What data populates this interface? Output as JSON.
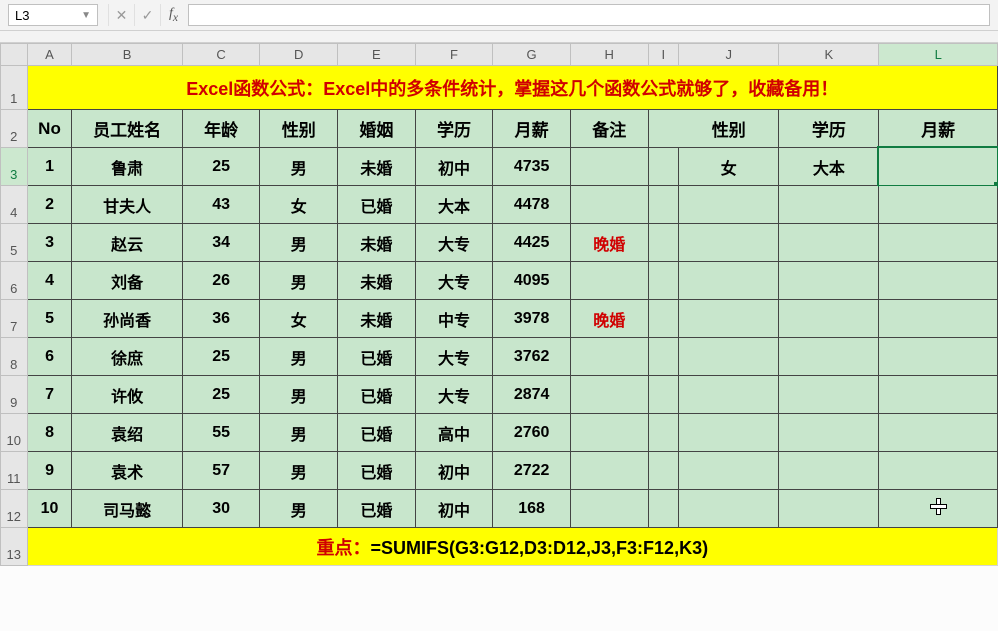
{
  "namebox": "L3",
  "formula_input": "",
  "columns": [
    "A",
    "B",
    "C",
    "D",
    "E",
    "F",
    "G",
    "H",
    "I",
    "J",
    "K",
    "L"
  ],
  "active_col": "L",
  "active_row": 3,
  "banner_text": "Excel函数公式：Excel中的多条件统计，掌握这几个函数公式就够了，收藏备用！",
  "headers": {
    "A": "No",
    "B": "员工姓名",
    "C": "年龄",
    "D": "性别",
    "E": "婚姻",
    "F": "学历",
    "G": "月薪",
    "H": "备注",
    "J": "性别",
    "K": "学历",
    "L": "月薪"
  },
  "rows": [
    {
      "no": "1",
      "name": "鲁肃",
      "age": "25",
      "sex": "男",
      "mar": "未婚",
      "edu": "初中",
      "sal": "4735",
      "note": "",
      "J": "女",
      "K": "大本",
      "L": ""
    },
    {
      "no": "2",
      "name": "甘夫人",
      "age": "43",
      "sex": "女",
      "mar": "已婚",
      "edu": "大本",
      "sal": "4478",
      "note": ""
    },
    {
      "no": "3",
      "name": "赵云",
      "age": "34",
      "sex": "男",
      "mar": "未婚",
      "edu": "大专",
      "sal": "4425",
      "note": "晚婚"
    },
    {
      "no": "4",
      "name": "刘备",
      "age": "26",
      "sex": "男",
      "mar": "未婚",
      "edu": "大专",
      "sal": "4095",
      "note": ""
    },
    {
      "no": "5",
      "name": "孙尚香",
      "age": "36",
      "sex": "女",
      "mar": "未婚",
      "edu": "中专",
      "sal": "3978",
      "note": "晚婚"
    },
    {
      "no": "6",
      "name": "徐庶",
      "age": "25",
      "sex": "男",
      "mar": "已婚",
      "edu": "大专",
      "sal": "3762",
      "note": ""
    },
    {
      "no": "7",
      "name": "许攸",
      "age": "25",
      "sex": "男",
      "mar": "已婚",
      "edu": "大专",
      "sal": "2874",
      "note": ""
    },
    {
      "no": "8",
      "name": "袁绍",
      "age": "55",
      "sex": "男",
      "mar": "已婚",
      "edu": "高中",
      "sal": "2760",
      "note": ""
    },
    {
      "no": "9",
      "name": "袁术",
      "age": "57",
      "sex": "男",
      "mar": "已婚",
      "edu": "初中",
      "sal": "2722",
      "note": ""
    },
    {
      "no": "10",
      "name": "司马懿",
      "age": "30",
      "sex": "男",
      "mar": "已婚",
      "edu": "初中",
      "sal": "168",
      "note": ""
    }
  ],
  "key_label": "重点：",
  "key_formula": "=SUMIFS(G3:G12,D3:D12,J3,F3:F12,K3)",
  "row_numbers": [
    "1",
    "2",
    "3",
    "4",
    "5",
    "6",
    "7",
    "8",
    "9",
    "10",
    "11",
    "12",
    "13"
  ],
  "chart_data": {
    "type": "table",
    "title": "Excel函数公式：Excel中的多条件统计",
    "columns": [
      "No",
      "员工姓名",
      "年龄",
      "性别",
      "婚姻",
      "学历",
      "月薪",
      "备注"
    ],
    "data": [
      [
        1,
        "鲁肃",
        25,
        "男",
        "未婚",
        "初中",
        4735,
        ""
      ],
      [
        2,
        "甘夫人",
        43,
        "女",
        "已婚",
        "大本",
        4478,
        ""
      ],
      [
        3,
        "赵云",
        34,
        "男",
        "未婚",
        "大专",
        4425,
        "晚婚"
      ],
      [
        4,
        "刘备",
        26,
        "男",
        "未婚",
        "大专",
        4095,
        ""
      ],
      [
        5,
        "孙尚香",
        36,
        "女",
        "未婚",
        "中专",
        3978,
        "晚婚"
      ],
      [
        6,
        "徐庶",
        25,
        "男",
        "已婚",
        "大专",
        3762,
        ""
      ],
      [
        7,
        "许攸",
        25,
        "男",
        "已婚",
        "大专",
        2874,
        ""
      ],
      [
        8,
        "袁绍",
        55,
        "男",
        "已婚",
        "高中",
        2760,
        ""
      ],
      [
        9,
        "袁术",
        57,
        "男",
        "已婚",
        "初中",
        2722,
        ""
      ],
      [
        10,
        "司马懿",
        30,
        "男",
        "已婚",
        "初中",
        168,
        ""
      ]
    ],
    "criteria": {
      "性别": "女",
      "学历": "大本",
      "月薪": ""
    },
    "formula": "=SUMIFS(G3:G12,D3:D12,J3,F3:F12,K3)"
  }
}
